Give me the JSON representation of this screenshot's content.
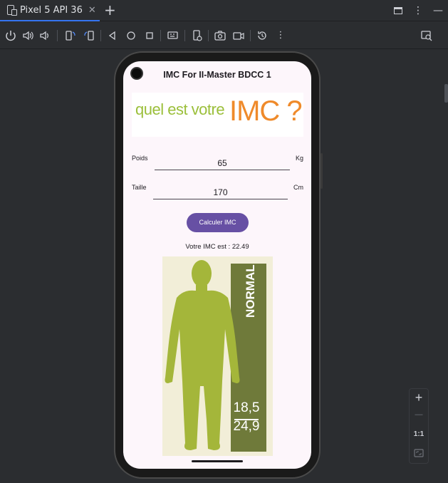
{
  "ide": {
    "tab": {
      "label": "Pixel 5 API 36",
      "close": "✕"
    },
    "add_tab": "+",
    "window_controls": [
      "▭",
      "⋮",
      "—"
    ],
    "toolbar_icons": [
      "power-icon",
      "volume-up-icon",
      "volume-down-icon",
      "rotate-left-icon",
      "rotate-right-icon",
      "back-icon",
      "home-icon",
      "overview-icon",
      "screenshot-icon",
      "camera-icon",
      "video-icon",
      "reset-icon",
      "more-icon",
      "inspect-icon"
    ],
    "zoom": {
      "plus": "+",
      "minus": "—",
      "ratio": "1:1"
    }
  },
  "app": {
    "title": "IMC For II-Master BDCC 1",
    "banner": {
      "small": "quel est votre",
      "big": "IMC ?"
    },
    "poids": {
      "label": "Poids",
      "value": "65",
      "unit": "Kg"
    },
    "taille": {
      "label": "Taille",
      "value": "170",
      "unit": "Cm"
    },
    "button": "Calculer IMC",
    "result": "Votre IMC est : 22.49",
    "figure": {
      "category": "NORMAL",
      "range_low": "18,5",
      "range_high": "24,9"
    }
  },
  "colors": {
    "accent": "#6750a4",
    "banner_green": "#9bbf3a",
    "banner_orange": "#ef8a2a",
    "band": "#6f7a3a",
    "figure": "#a4b63a"
  }
}
